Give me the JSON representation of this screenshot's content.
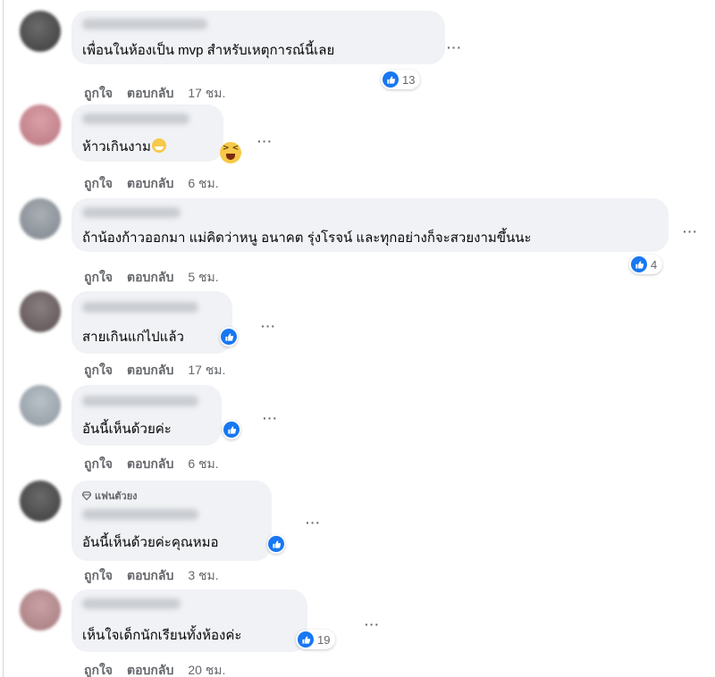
{
  "actions": {
    "like": "ถูกใจ",
    "reply": "ตอบกลับ"
  },
  "icons": {
    "more": "more-options-icon",
    "like": "like-reaction-icon",
    "badge": "diamond-icon"
  },
  "colors": {
    "like_blue": "#1877f2",
    "bubble_bg": "#f0f2f5",
    "muted_text": "#65676b"
  },
  "comments": [
    {
      "text": "เพื่อนในห้องเป็น mvp สำหรับเหตุการณ์นี้เลย",
      "reaction_count": "13",
      "time": "17 ชม."
    },
    {
      "text": "ห้าวเกินงาม",
      "reaction_count": "",
      "time": "6 ชม."
    },
    {
      "text": "ถ้าน้องก้าวออกมา แม่คิดว่าหนู อนาคต รุ่งโรจน์ และทุกอย่างก็จะสวยงามขึ้นนะ",
      "reaction_count": "4",
      "time": "5 ชม."
    },
    {
      "text": "สายเกินแก่ไปแล้ว",
      "reaction_count": "",
      "time": "17 ชม."
    },
    {
      "text": "อันนี้เห็นด้วยค่ะ",
      "reaction_count": "",
      "time": "6 ชม."
    },
    {
      "badge": "แฟนตัวยง",
      "text": "อันนี้เห็นด้วยค่ะคุณหมอ",
      "reaction_count": "",
      "time": "3 ชม."
    },
    {
      "text": "เห็นใจเด็กนักเรียนทั้งห้องค่ะ",
      "reaction_count": "19",
      "time": "20 ชม."
    }
  ]
}
